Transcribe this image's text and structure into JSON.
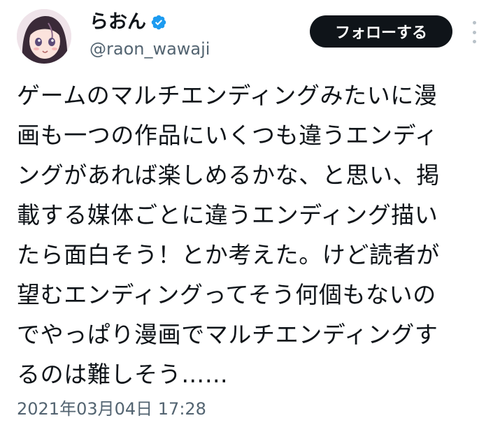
{
  "user": {
    "display_name": "らおん",
    "handle": "@raon_wawaji",
    "verified": true,
    "avatar_icon": "avatar-image"
  },
  "actions": {
    "follow_label": "フォローする",
    "more_icon": "more-vertical-icon"
  },
  "tweet": {
    "lines": [
      "ゲームのマルチエンディングみたいに漫",
      "画も一つの作品にいくつも違うエンディ",
      "ングがあれば楽しめるかな、と思い、掲",
      "載する媒体ごとに違うエンディング描い",
      "たら面白そう！とか考えた。けど読者が",
      "望むエンディングってそう何個もないの",
      "でやっぱり漫画でマルチエンディングす",
      "るのは難しそう……"
    ],
    "timestamp": "2021年03月04日 17:28"
  },
  "colors": {
    "text_primary": "#0f1419",
    "text_secondary": "#536471",
    "verified_blue": "#1d9bf0",
    "button_bg": "#0f1419",
    "button_text": "#ffffff"
  }
}
